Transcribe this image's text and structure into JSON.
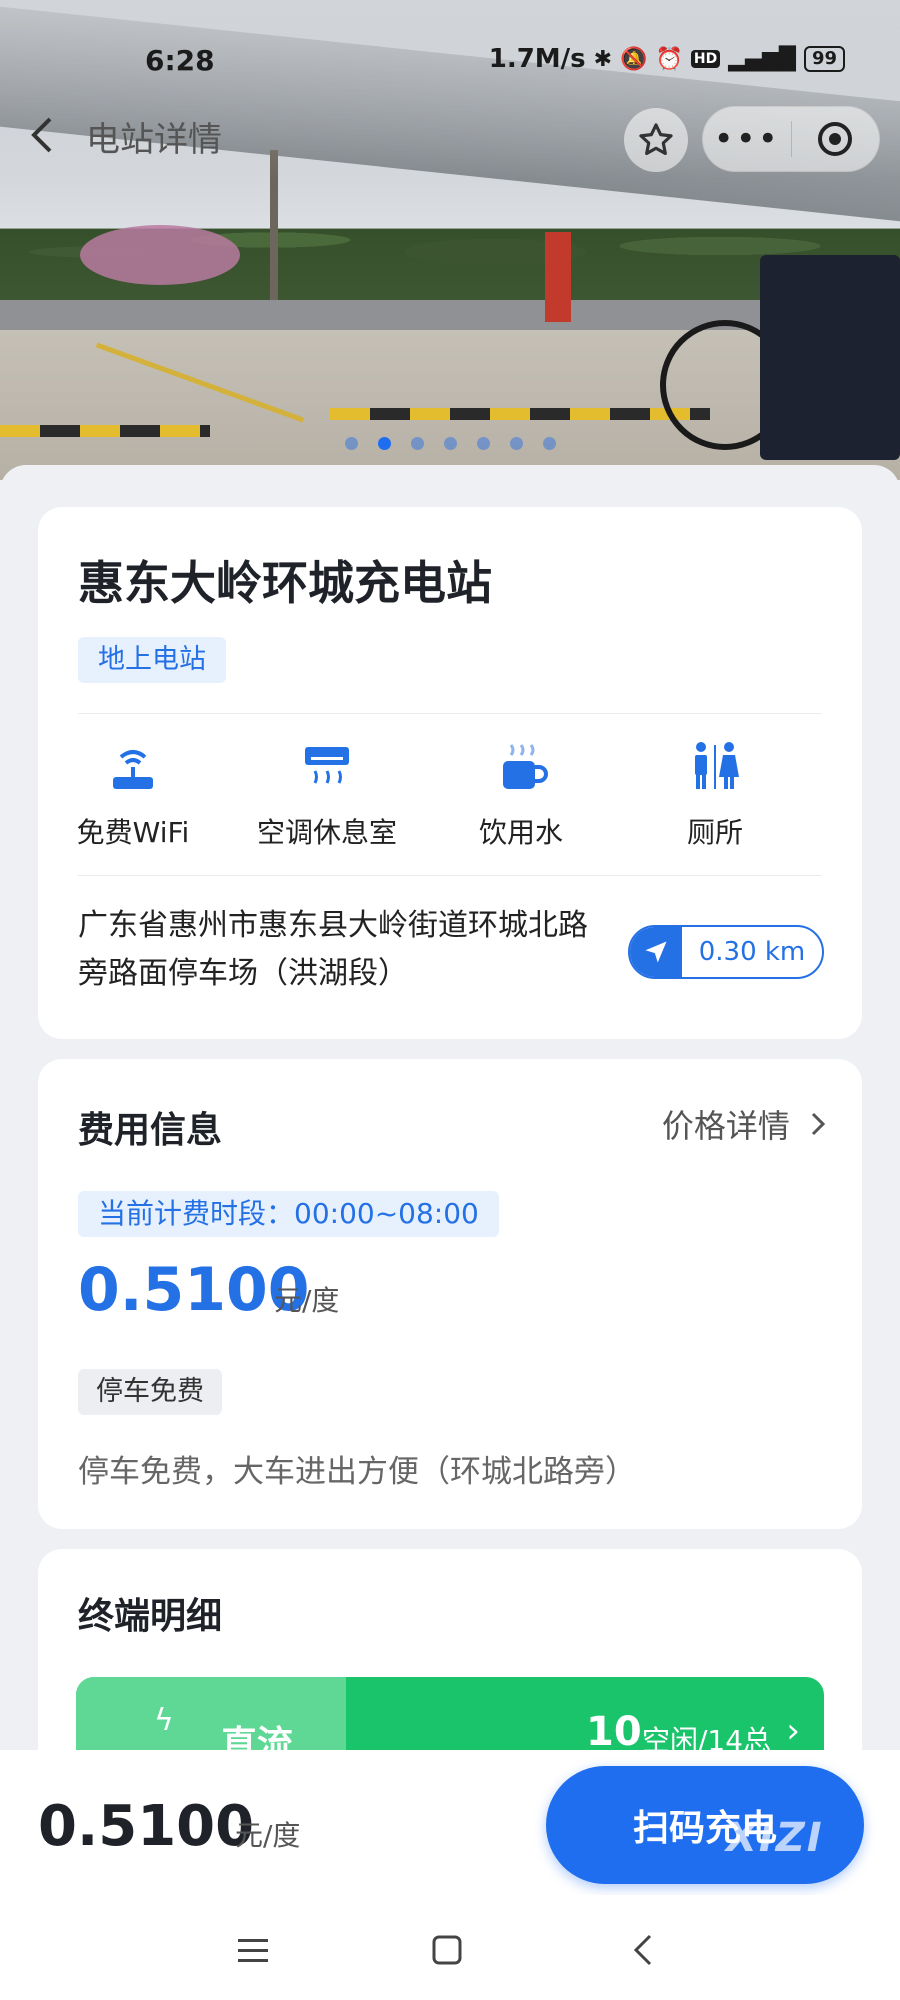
{
  "status_bar": {
    "time": "6:28",
    "network_speed": "1.7M/s",
    "icons": [
      "bluetooth-icon",
      "mute-icon",
      "alarm-icon",
      "hd-icon",
      "signal-4g-icon"
    ],
    "battery": "99"
  },
  "nav": {
    "title": "电站详情",
    "back_icon": "chevron-left-icon",
    "favorite_icon": "star-icon",
    "more_icon": "more-dots-icon",
    "close_icon": "target-circle-icon"
  },
  "gallery": {
    "count": 7,
    "active_index": 1
  },
  "station": {
    "name": "惠东大岭环城充电站",
    "type_tag": "地上电站",
    "amenities": [
      {
        "icon": "wifi-router-icon",
        "label": "免费WiFi"
      },
      {
        "icon": "air-conditioner-icon",
        "label": "空调休息室"
      },
      {
        "icon": "hot-cup-icon",
        "label": "饮用水"
      },
      {
        "icon": "restroom-icon",
        "label": "厕所"
      }
    ],
    "address": "广东省惠州市惠东县大岭街道环城北路旁路面停车场（洪湖段）",
    "distance": "0.30 km"
  },
  "fee": {
    "title": "费用信息",
    "detail_link": "价格详情",
    "period": "当前计费时段：00:00~08:00",
    "price": "0.5100",
    "unit": "元/度",
    "parking_tag": "停车免费",
    "parking_note": "停车免费，大车进出方便（环城北路旁）"
  },
  "terminals": {
    "title": "终端明细",
    "rows": [
      {
        "kind": "直流",
        "idle": "10",
        "idle_total": "空闲/14总"
      }
    ]
  },
  "bottom_bar": {
    "price": "0.5100",
    "unit": "元/度",
    "scan_button": "扫码充电",
    "watermark": "XIZI"
  },
  "colors": {
    "primary": "#1f6ef0",
    "tag_blue_bg": "#e7f0fd",
    "green": "#19c46b"
  }
}
